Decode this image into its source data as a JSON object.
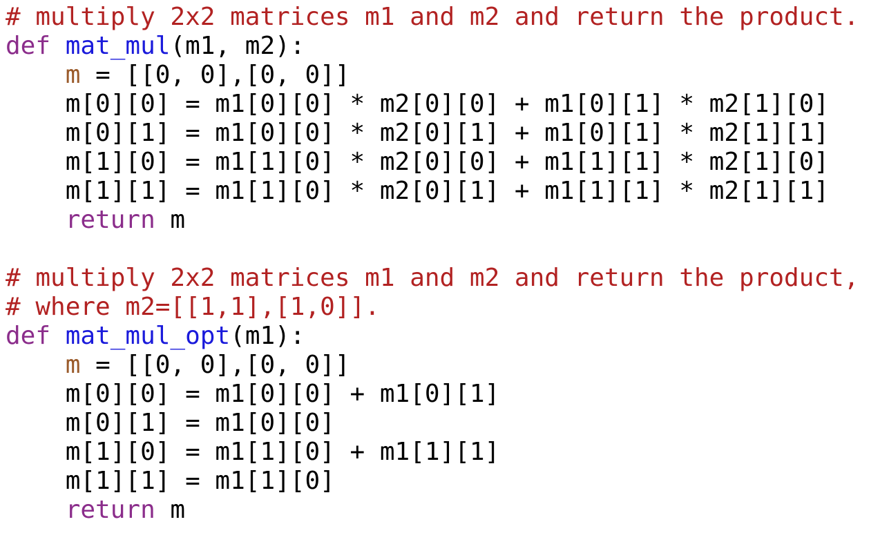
{
  "editor": {
    "colors": {
      "comment": "#b22222",
      "keyword": "#8b2d8b",
      "function_name": "#1a1adb",
      "variable": "#9a5a2a",
      "text": "#000000",
      "background": "#ffffff"
    },
    "lines": [
      [
        {
          "t": "comment",
          "v": "# multiply 2x2 matrices m1 and m2 and return the product."
        }
      ],
      [
        {
          "t": "keyword",
          "v": "def"
        },
        {
          "t": "plain",
          "v": " "
        },
        {
          "t": "funcname",
          "v": "mat_mul"
        },
        {
          "t": "plain",
          "v": "(m1, m2):"
        }
      ],
      [
        {
          "t": "plain",
          "v": "    "
        },
        {
          "t": "variable",
          "v": "m"
        },
        {
          "t": "plain",
          "v": " = [[0, 0],[0, 0]]"
        }
      ],
      [
        {
          "t": "plain",
          "v": "    m[0][0] = m1[0][0] * m2[0][0] + m1[0][1] * m2[1][0]"
        }
      ],
      [
        {
          "t": "plain",
          "v": "    m[0][1] = m1[0][0] * m2[0][1] + m1[0][1] * m2[1][1]"
        }
      ],
      [
        {
          "t": "plain",
          "v": "    m[1][0] = m1[1][0] * m2[0][0] + m1[1][1] * m2[1][0]"
        }
      ],
      [
        {
          "t": "plain",
          "v": "    m[1][1] = m1[1][0] * m2[0][1] + m1[1][1] * m2[1][1]"
        }
      ],
      [
        {
          "t": "plain",
          "v": "    "
        },
        {
          "t": "keyword",
          "v": "return"
        },
        {
          "t": "plain",
          "v": " m"
        }
      ],
      [
        {
          "t": "plain",
          "v": ""
        }
      ],
      [
        {
          "t": "comment",
          "v": "# multiply 2x2 matrices m1 and m2 and return the product,"
        }
      ],
      [
        {
          "t": "comment",
          "v": "# where m2=[[1,1],[1,0]]."
        }
      ],
      [
        {
          "t": "keyword",
          "v": "def"
        },
        {
          "t": "plain",
          "v": " "
        },
        {
          "t": "funcname",
          "v": "mat_mul_opt"
        },
        {
          "t": "plain",
          "v": "(m1):"
        }
      ],
      [
        {
          "t": "plain",
          "v": "    "
        },
        {
          "t": "variable",
          "v": "m"
        },
        {
          "t": "plain",
          "v": " = [[0, 0],[0, 0]]"
        }
      ],
      [
        {
          "t": "plain",
          "v": "    m[0][0] = m1[0][0] + m1[0][1]"
        }
      ],
      [
        {
          "t": "plain",
          "v": "    m[0][1] = m1[0][0]"
        }
      ],
      [
        {
          "t": "plain",
          "v": "    m[1][0] = m1[1][0] + m1[1][1]"
        }
      ],
      [
        {
          "t": "plain",
          "v": "    m[1][1] = m1[1][0]"
        }
      ],
      [
        {
          "t": "plain",
          "v": "    "
        },
        {
          "t": "keyword",
          "v": "return"
        },
        {
          "t": "plain",
          "v": " m"
        }
      ]
    ]
  }
}
